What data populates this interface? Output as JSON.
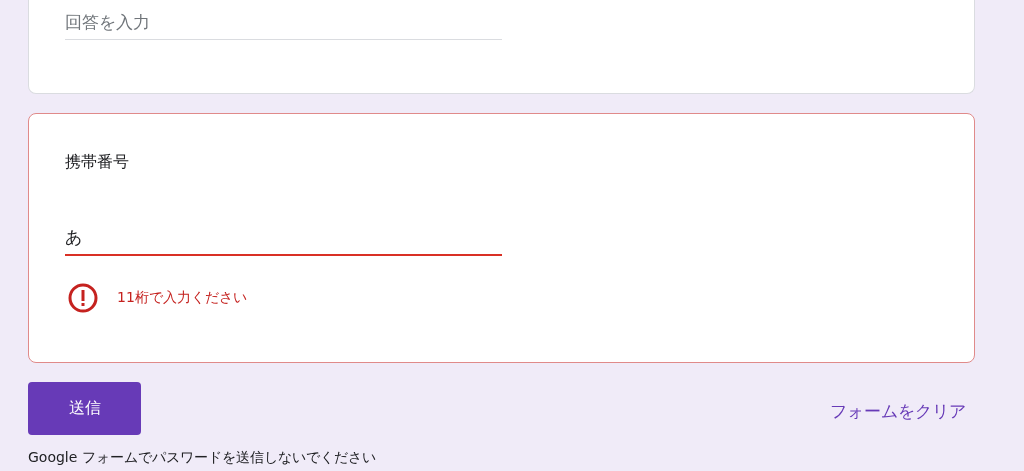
{
  "questions": [
    {
      "kind": "short_answer",
      "placeholder": "回答を入力",
      "has_error": false
    },
    {
      "kind": "short_answer",
      "title": "携帯番号",
      "value": "あ",
      "has_error": true,
      "error": "11桁で入力ください"
    }
  ],
  "submit_button": "送信",
  "clear_button": "フォームをクリア",
  "footer_note": "Google フォームでパスワードを送信しないでください"
}
